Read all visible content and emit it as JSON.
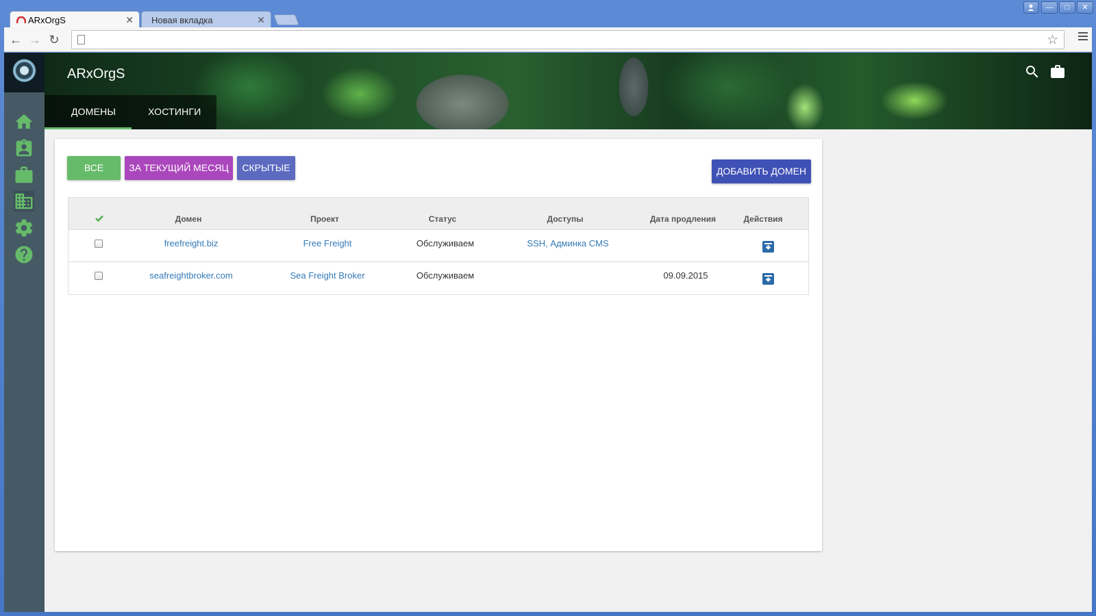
{
  "browser": {
    "tabs": [
      {
        "title": "ARxOrgS",
        "active": true
      },
      {
        "title": "Новая вкладка",
        "active": false
      }
    ],
    "address": ""
  },
  "app": {
    "title": "ARxOrgS",
    "nav_tabs": [
      "ДОМЕНЫ",
      "ХОСТИНГИ"
    ],
    "active_tab": "ДОМЕНЫ",
    "sidebar_icons": [
      "home-icon",
      "assignment-ind-icon",
      "briefcase-icon",
      "domain-icon",
      "settings-icon",
      "help-icon"
    ],
    "header_icons": [
      "search-icon",
      "briefcase-icon"
    ]
  },
  "filters": {
    "all": "ВСЕ",
    "current_month": "ЗА ТЕКУЩИЙ МЕСЯЦ",
    "hidden": "СКРЫТЫЕ",
    "add_domain": "ДОБАВИТЬ ДОМЕН"
  },
  "table": {
    "columns": [
      "Домен",
      "Проект",
      "Статус",
      "Доступы",
      "Дата продления",
      "Действия"
    ],
    "rows": [
      {
        "domain": "freefreight.biz",
        "project": "Free Freight",
        "status": "Обслуживаем",
        "access": "SSH, Админка CMS",
        "renewal": ""
      },
      {
        "domain": "seafreightbroker.com",
        "project": "Sea Freight Broker",
        "status": "Обслуживаем",
        "access": "",
        "renewal": "09.09.2015"
      }
    ]
  },
  "colors": {
    "sidebar": "#455a64",
    "accent_green": "#66bb6a",
    "accent_purple": "#ab47bc",
    "accent_indigo": "#5c6bc0",
    "accent_blue": "#3f51b5",
    "link": "#337ab7"
  }
}
